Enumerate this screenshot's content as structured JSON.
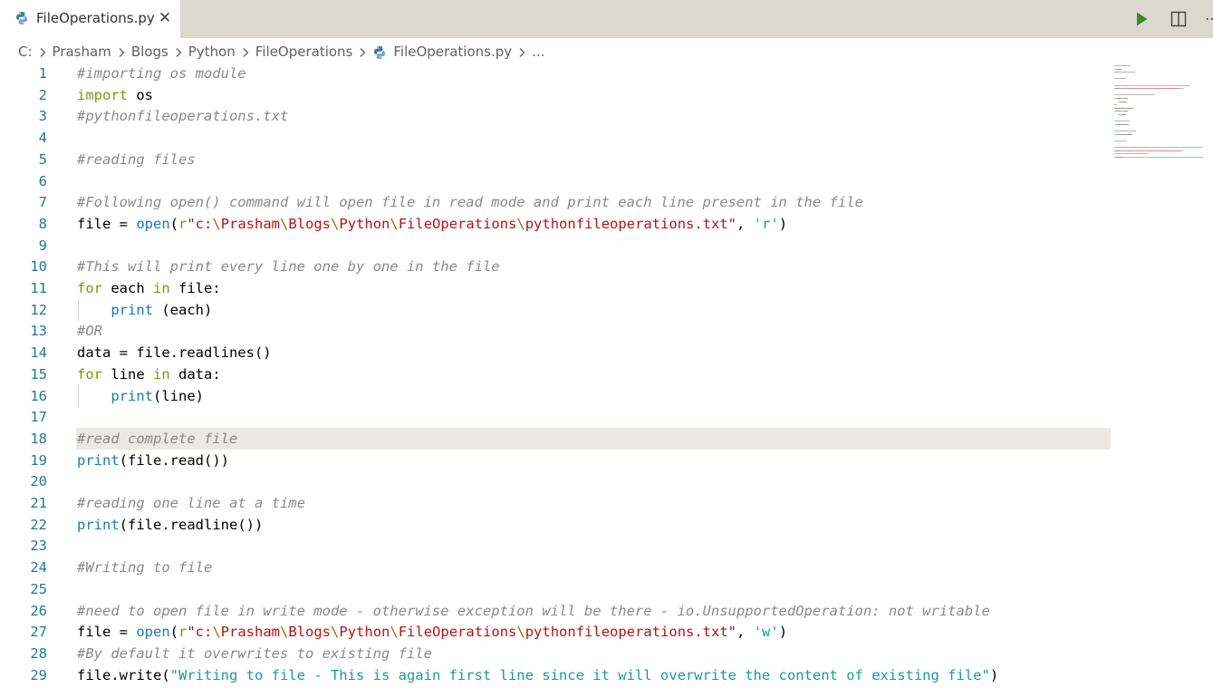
{
  "colors": {
    "tabbar_bg": "#ddd8ce",
    "comment": "#8a8a8a",
    "keyword": "#799a0b",
    "builtin": "#1f77b4",
    "string": "#b31515",
    "escape": "#8a7015",
    "string_teal": "#1c9a96",
    "line_number": "#237893",
    "current_line": "#ebe9e1",
    "run": "#388a34"
  },
  "tab": {
    "label": "FileOperations.py",
    "close": "✕",
    "icon": "python-file-icon"
  },
  "actions": {
    "run_icon": "run-play-icon",
    "split_icon": "split-editor-icon",
    "more": "⋯"
  },
  "breadcrumb": {
    "items": [
      "C:",
      "Prasham",
      "Blogs",
      "Python",
      "FileOperations",
      "FileOperations.py",
      "..."
    ]
  },
  "editor": {
    "current_line": 18,
    "lines": [
      {
        "n": "1",
        "tokens": [
          [
            "comment",
            "#importing os module"
          ]
        ]
      },
      {
        "n": "2",
        "tokens": [
          [
            "keyword",
            "import"
          ],
          [
            "plain",
            " os"
          ]
        ]
      },
      {
        "n": "3",
        "tokens": [
          [
            "comment",
            "#pythonfileoperations.txt"
          ]
        ]
      },
      {
        "n": "4",
        "tokens": []
      },
      {
        "n": "5",
        "tokens": [
          [
            "comment",
            "#reading files"
          ]
        ]
      },
      {
        "n": "6",
        "tokens": []
      },
      {
        "n": "7",
        "tokens": [
          [
            "comment",
            "#Following open() command will open file in read mode and print each line present in the file"
          ]
        ]
      },
      {
        "n": "8",
        "tokens": [
          [
            "plain",
            "file = "
          ],
          [
            "builtin",
            "open"
          ],
          [
            "plain",
            "("
          ],
          [
            "keyword",
            "r"
          ],
          [
            "str",
            "\"c:"
          ],
          [
            "esc",
            "\\"
          ],
          [
            "str",
            "Prasham"
          ],
          [
            "esc",
            "\\"
          ],
          [
            "str",
            "Blogs"
          ],
          [
            "esc",
            "\\"
          ],
          [
            "str",
            "Python"
          ],
          [
            "esc",
            "\\"
          ],
          [
            "str",
            "FileOperations"
          ],
          [
            "esc",
            "\\"
          ],
          [
            "str",
            "pythonfileoperations.txt\""
          ],
          [
            "plain",
            ", "
          ],
          [
            "str2",
            "'r'"
          ],
          [
            "plain",
            ")"
          ]
        ]
      },
      {
        "n": "9",
        "tokens": []
      },
      {
        "n": "10",
        "tokens": [
          [
            "comment",
            "#This will print every line one by one in the file"
          ]
        ]
      },
      {
        "n": "11",
        "tokens": [
          [
            "keyword",
            "for"
          ],
          [
            "plain",
            " each "
          ],
          [
            "keyword",
            "in"
          ],
          [
            "plain",
            " file:"
          ]
        ]
      },
      {
        "n": "12",
        "guide": true,
        "tokens": [
          [
            "plain",
            "    "
          ],
          [
            "builtin",
            "print"
          ],
          [
            "plain",
            " (each)"
          ]
        ]
      },
      {
        "n": "13",
        "tokens": [
          [
            "comment",
            "#OR"
          ]
        ]
      },
      {
        "n": "14",
        "tokens": [
          [
            "plain",
            "data = file.readlines()"
          ]
        ]
      },
      {
        "n": "15",
        "tokens": [
          [
            "keyword",
            "for"
          ],
          [
            "plain",
            " line "
          ],
          [
            "keyword",
            "in"
          ],
          [
            "plain",
            " data:"
          ]
        ]
      },
      {
        "n": "16",
        "guide": true,
        "tokens": [
          [
            "plain",
            "    "
          ],
          [
            "builtin",
            "print"
          ],
          [
            "plain",
            "(line)"
          ]
        ]
      },
      {
        "n": "17",
        "tokens": []
      },
      {
        "n": "18",
        "tokens": [
          [
            "comment",
            "#read complete file"
          ]
        ]
      },
      {
        "n": "19",
        "tokens": [
          [
            "builtin",
            "print"
          ],
          [
            "plain",
            "(file.read())"
          ]
        ]
      },
      {
        "n": "20",
        "tokens": []
      },
      {
        "n": "21",
        "tokens": [
          [
            "comment",
            "#reading one line at a time"
          ]
        ]
      },
      {
        "n": "22",
        "tokens": [
          [
            "builtin",
            "print"
          ],
          [
            "plain",
            "(file.readline())"
          ]
        ]
      },
      {
        "n": "23",
        "tokens": []
      },
      {
        "n": "24",
        "tokens": [
          [
            "comment",
            "#Writing to file"
          ]
        ]
      },
      {
        "n": "25",
        "tokens": []
      },
      {
        "n": "26",
        "tokens": [
          [
            "comment",
            "#need to open file in write mode - otherwise exception will be there - io.UnsupportedOperation: not writable"
          ]
        ]
      },
      {
        "n": "27",
        "tokens": [
          [
            "plain",
            "file = "
          ],
          [
            "builtin",
            "open"
          ],
          [
            "plain",
            "("
          ],
          [
            "keyword",
            "r"
          ],
          [
            "str",
            "\"c:"
          ],
          [
            "esc",
            "\\"
          ],
          [
            "str",
            "Prasham"
          ],
          [
            "esc",
            "\\"
          ],
          [
            "str",
            "Blogs"
          ],
          [
            "esc",
            "\\"
          ],
          [
            "str",
            "Python"
          ],
          [
            "esc",
            "\\"
          ],
          [
            "str",
            "FileOperations"
          ],
          [
            "esc",
            "\\"
          ],
          [
            "str",
            "pythonfileoperations.txt\""
          ],
          [
            "plain",
            ", "
          ],
          [
            "str2",
            "'w'"
          ],
          [
            "plain",
            ")"
          ]
        ]
      },
      {
        "n": "28",
        "tokens": [
          [
            "comment",
            "#By default it overwrites to existing file"
          ]
        ]
      },
      {
        "n": "29",
        "tokens": [
          [
            "plain",
            "file.write("
          ],
          [
            "str2",
            "\"Writing to file - This is again first line since it will overwrite the content of existing file\""
          ],
          [
            "plain",
            ")"
          ]
        ]
      }
    ]
  }
}
